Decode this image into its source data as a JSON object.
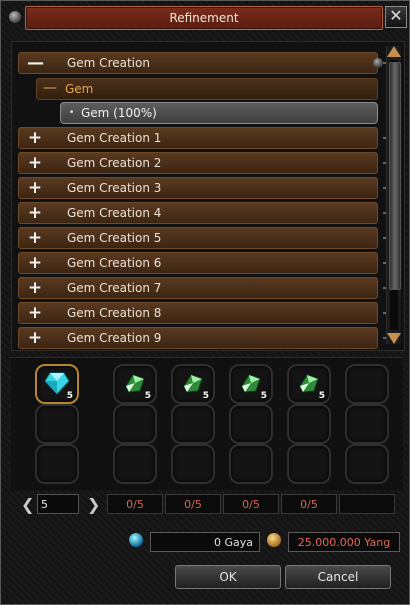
{
  "window": {
    "title": "Refinement",
    "close_glyph": "✕"
  },
  "tree": {
    "expanded_category": {
      "sign": "—",
      "label": "Gem Creation"
    },
    "subcategory": {
      "sign": "—",
      "label": "Gem"
    },
    "selected_item": {
      "label": "Gem (100%)"
    },
    "collapsed_categories": [
      {
        "sign": "+",
        "label": "Gem Creation 1"
      },
      {
        "sign": "+",
        "label": "Gem Creation 2"
      },
      {
        "sign": "+",
        "label": "Gem Creation 3"
      },
      {
        "sign": "+",
        "label": "Gem Creation 4"
      },
      {
        "sign": "+",
        "label": "Gem Creation 5"
      },
      {
        "sign": "+",
        "label": "Gem Creation 6"
      },
      {
        "sign": "+",
        "label": "Gem Creation 7"
      },
      {
        "sign": "+",
        "label": "Gem Creation 8"
      },
      {
        "sign": "+",
        "label": "Gem Creation 9"
      }
    ]
  },
  "result": {
    "icon": "cyan-gem-icon",
    "quantity": "5"
  },
  "materials": [
    {
      "icon": "green-ore-icon",
      "quantity": "5",
      "count": "0/5"
    },
    {
      "icon": "green-ore-icon",
      "quantity": "5",
      "count": "0/5"
    },
    {
      "icon": "green-ore-icon",
      "quantity": "5",
      "count": "0/5"
    },
    {
      "icon": "green-ore-icon",
      "quantity": "5",
      "count": "0/5"
    }
  ],
  "amount": {
    "value": "5",
    "prev_glyph": "❮",
    "next_glyph": "❯"
  },
  "costs": {
    "gaya": "0 Gaya",
    "yang": "25.000.000 Yang"
  },
  "buttons": {
    "ok": "OK",
    "cancel": "Cancel"
  },
  "colors": {
    "title_bar": "#6a2416",
    "row": "#4a2e18",
    "subcategory_text": "#e5a94e",
    "yang_text": "#e06a5a",
    "count_text": "#d26a5a"
  }
}
